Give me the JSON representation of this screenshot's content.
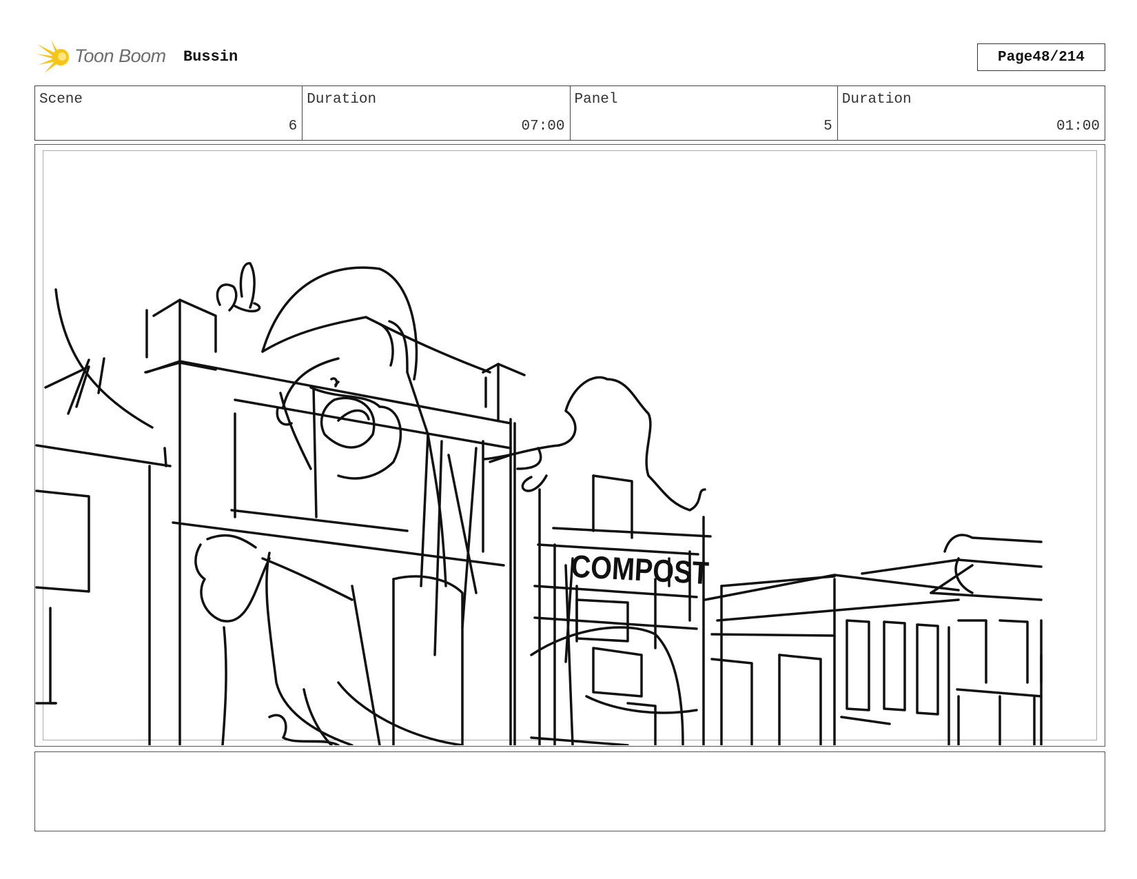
{
  "header": {
    "logo_text": "Toon Boom",
    "logo_icon": "toon-boom-burst-icon",
    "project_title": "Bussin",
    "page_label": "Page",
    "page_number": "48/214"
  },
  "info": {
    "scene_label": "Scene",
    "scene_value": "6",
    "scene_duration_label": "Duration",
    "scene_duration_value": "07:00",
    "panel_label": "Panel",
    "panel_value": "5",
    "panel_duration_label": "Duration",
    "panel_duration_value": "01:00"
  },
  "panel": {
    "sign_text": "COMPOST"
  },
  "notes": {
    "text": ""
  },
  "colors": {
    "logo_accent": "#f5c518",
    "logo_text": "#6d6d6d",
    "ink": "#111111"
  }
}
